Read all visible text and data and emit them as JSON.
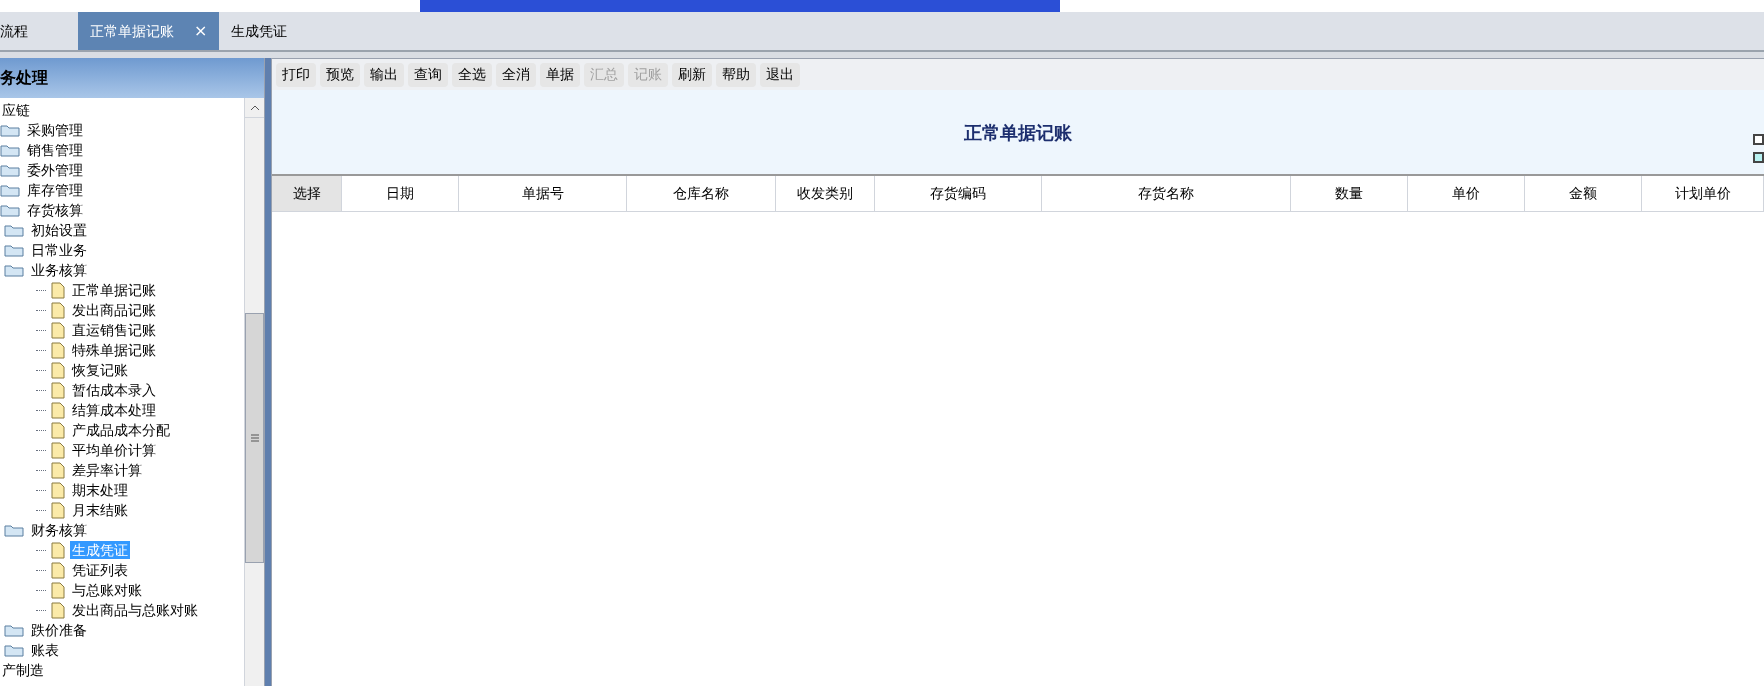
{
  "tabs": [
    {
      "label": "流程",
      "selected": false
    },
    {
      "label": "正常单据记账",
      "selected": true,
      "close": "×"
    },
    {
      "label": "生成凭证",
      "selected": false
    }
  ],
  "sidebar": {
    "title": "务处理",
    "tree": [
      {
        "label": "应链",
        "selected": false,
        "children": [
          {
            "label": "采购管理",
            "selected": false
          },
          {
            "label": "销售管理",
            "selected": false
          },
          {
            "label": "委外管理",
            "selected": false
          },
          {
            "label": "库存管理",
            "selected": false
          },
          {
            "label": "存货核算",
            "selected": false,
            "children": [
              {
                "label": "初始设置",
                "selected": false
              },
              {
                "label": "日常业务",
                "selected": false
              },
              {
                "label": "业务核算",
                "selected": false,
                "children": [
                  {
                    "label": "正常单据记账",
                    "selected": false
                  },
                  {
                    "label": "发出商品记账",
                    "selected": false
                  },
                  {
                    "label": "直运销售记账",
                    "selected": false
                  },
                  {
                    "label": "特殊单据记账",
                    "selected": false
                  },
                  {
                    "label": "恢复记账",
                    "selected": false
                  },
                  {
                    "label": "暂估成本录入",
                    "selected": false
                  },
                  {
                    "label": "结算成本处理",
                    "selected": false
                  },
                  {
                    "label": "产成品成本分配",
                    "selected": false
                  },
                  {
                    "label": "平均单价计算",
                    "selected": false
                  },
                  {
                    "label": "差异率计算",
                    "selected": false
                  },
                  {
                    "label": "期末处理",
                    "selected": false
                  },
                  {
                    "label": "月末结账",
                    "selected": false
                  }
                ]
              },
              {
                "label": "财务核算",
                "selected": false,
                "children": [
                  {
                    "label": "生成凭证",
                    "selected": true
                  },
                  {
                    "label": "凭证列表",
                    "selected": false
                  },
                  {
                    "label": "与总账对账",
                    "selected": false
                  },
                  {
                    "label": "发出商品与总账对账",
                    "selected": false
                  }
                ]
              },
              {
                "label": "跌价准备",
                "selected": false
              },
              {
                "label": "账表",
                "selected": false
              }
            ]
          }
        ]
      },
      {
        "label": "产制造",
        "selected": false
      }
    ]
  },
  "toolbar": [
    {
      "label": "打印",
      "disabled": false
    },
    {
      "label": "预览",
      "disabled": false
    },
    {
      "label": "输出",
      "disabled": false
    },
    {
      "label": "查询",
      "disabled": false
    },
    {
      "label": "全选",
      "disabled": false
    },
    {
      "label": "全消",
      "disabled": false
    },
    {
      "label": "单据",
      "disabled": false
    },
    {
      "label": "汇总",
      "disabled": true
    },
    {
      "label": "记账",
      "disabled": true
    },
    {
      "label": "刷新",
      "disabled": false
    },
    {
      "label": "帮助",
      "disabled": false
    },
    {
      "label": "退出",
      "disabled": false
    }
  ],
  "title": "正常单据记账",
  "table": {
    "columns": [
      "选择",
      "日期",
      "单据号",
      "仓库名称",
      "收发类别",
      "存货编码",
      "存货名称",
      "数量",
      "单价",
      "金额",
      "计划单价"
    ]
  }
}
